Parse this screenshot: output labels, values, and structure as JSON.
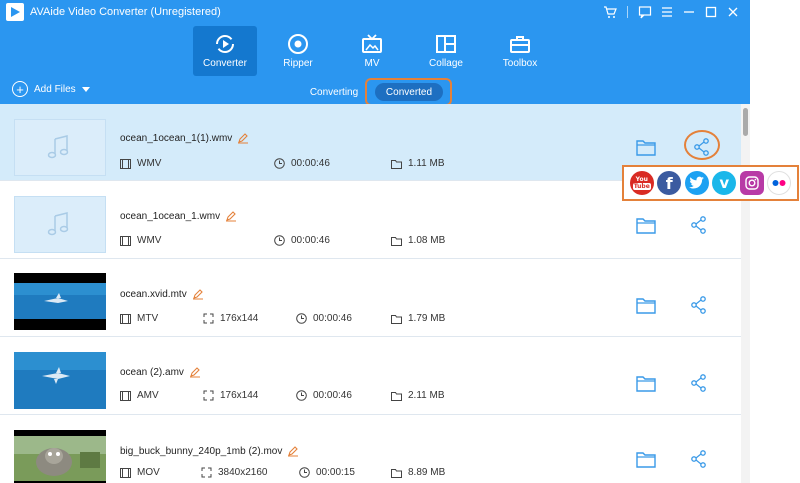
{
  "app": {
    "title": "AVAide Video Converter (Unregistered)"
  },
  "nav": {
    "items": [
      {
        "label": "Converter",
        "icon": "converter-icon",
        "active": true
      },
      {
        "label": "Ripper",
        "icon": "ripper-icon"
      },
      {
        "label": "MV",
        "icon": "mv-icon"
      },
      {
        "label": "Collage",
        "icon": "collage-icon"
      },
      {
        "label": "Toolbox",
        "icon": "toolbox-icon"
      }
    ]
  },
  "toolbar": {
    "add_files_label": "Add Files",
    "tab_converting": "Converting",
    "tab_converted": "Converted",
    "active_tab": "Converted"
  },
  "files": [
    {
      "name": "ocean_1ocean_1(1).wmv",
      "format": "WMV",
      "duration": "00:00:46",
      "size": "1.11 MB",
      "type": "audio",
      "selected": true
    },
    {
      "name": "ocean_1ocean_1.wmv",
      "format": "WMV",
      "duration": "00:00:46",
      "size": "1.08 MB",
      "type": "audio"
    },
    {
      "name": "ocean.xvid.mtv",
      "format": "MTV",
      "resolution": "176x144",
      "duration": "00:00:46",
      "size": "1.79 MB",
      "type": "video"
    },
    {
      "name": "ocean (2).amv",
      "format": "AMV",
      "resolution": "176x144",
      "duration": "00:00:46",
      "size": "2.11 MB",
      "type": "video"
    },
    {
      "name": "big_buck_bunny_240p_1mb (2).mov",
      "format": "MOV",
      "resolution": "3840x2160",
      "duration": "00:00:15",
      "size": "8.89 MB",
      "type": "video"
    }
  ],
  "share": {
    "platforms": [
      {
        "name": "YouTube",
        "icon": "youtube-icon",
        "color": "#d92b24",
        "text_top": "You",
        "text_bottom": "Tube"
      },
      {
        "name": "Facebook",
        "icon": "facebook-icon",
        "color": "#3b5ba0",
        "glyph": "f"
      },
      {
        "name": "Twitter",
        "icon": "twitter-icon",
        "color": "#1da1f2"
      },
      {
        "name": "Vimeo",
        "icon": "vimeo-icon",
        "color": "#1ab7ea",
        "glyph": "v"
      },
      {
        "name": "Instagram",
        "icon": "instagram-icon",
        "color": "#b83aa6"
      },
      {
        "name": "Flickr",
        "icon": "flickr-icon",
        "color": "#ffffff"
      }
    ]
  },
  "colors": {
    "header": "#2b96f0",
    "accent_dark": "#1478cf",
    "highlight": "#e4813a",
    "selected_row": "#d4ebfa"
  }
}
